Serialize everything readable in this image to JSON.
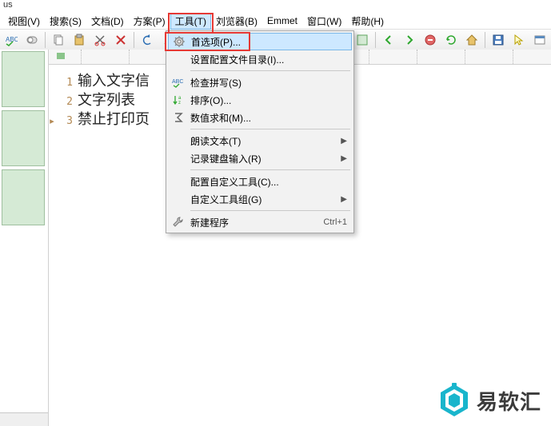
{
  "title": "us",
  "menubar": {
    "view": "视图(V)",
    "search": "搜索(S)",
    "doc": "文档(D)",
    "scheme": "方案(P)",
    "tools": "工具(T)",
    "browser": "刘览器(B)",
    "emmet": "Emmet",
    "window": "窗口(W)",
    "help": "帮助(H)"
  },
  "dropdown": {
    "preferences": "首选项(P)...",
    "config_dir": "设置配置文件目录(I)...",
    "spellcheck": "检查拼写(S)",
    "sort": "排序(O)...",
    "sum": "数值求和(M)...",
    "read_aloud": "朗读文本(T)",
    "record_keyboard": "记录键盘输入(R)",
    "configure_tools": "配置自定义工具(C)...",
    "toolgroups": "自定义工具组(G)",
    "new_program": "新建程序",
    "new_program_shortcut": "Ctrl+1"
  },
  "editor": {
    "lines": {
      "l1": "输入文字信",
      "l2": "文字列表",
      "l3": "禁止打印页"
    }
  },
  "watermark": "易软汇"
}
